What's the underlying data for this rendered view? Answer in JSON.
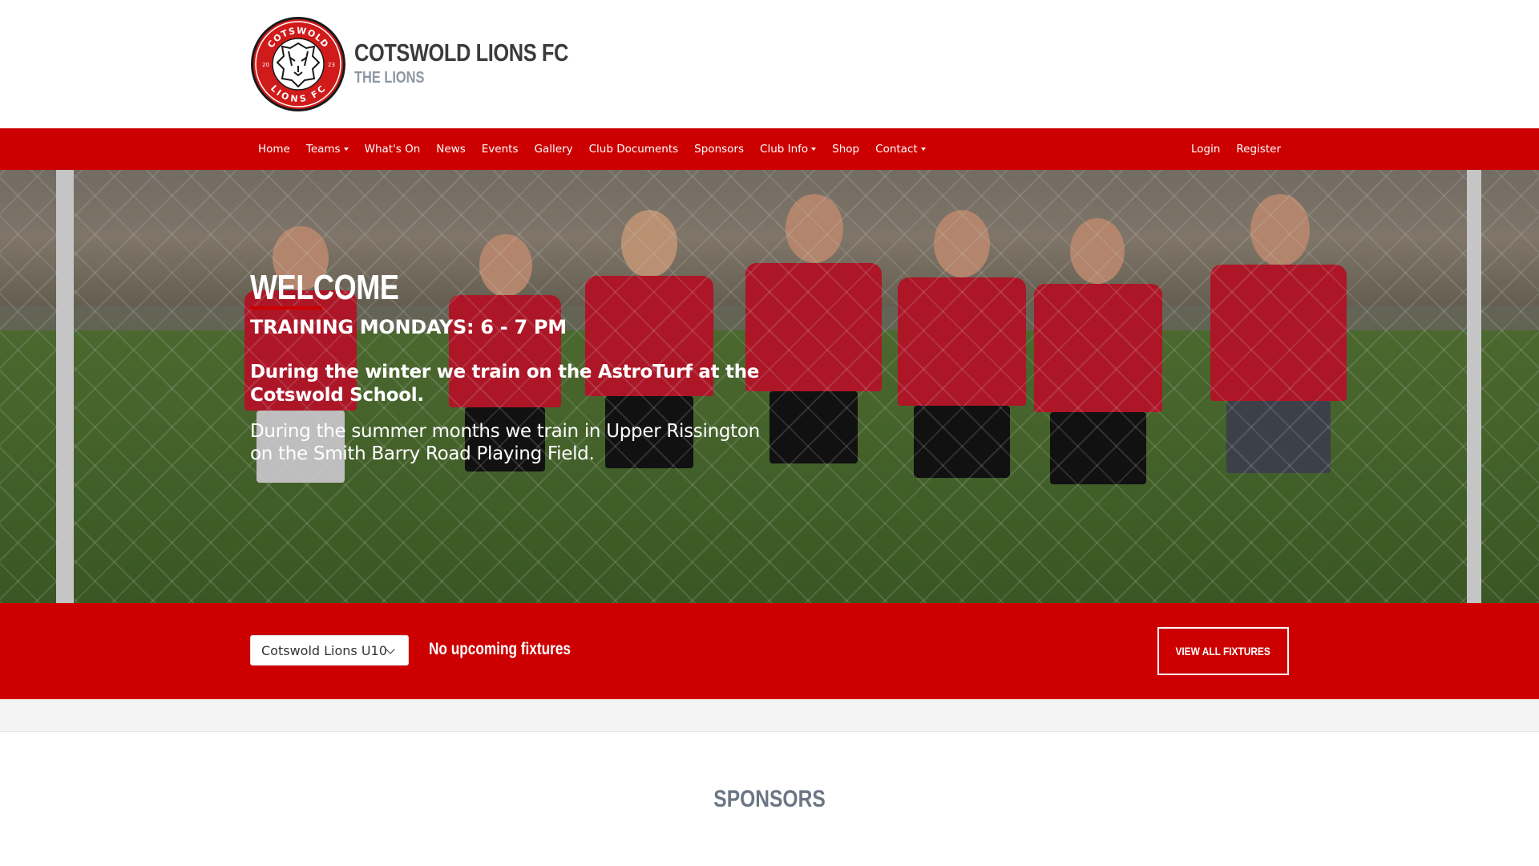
{
  "brand": {
    "title": "COTSWOLD LIONS FC",
    "subtitle": "THE LIONS",
    "crest_text_top": "COTSWOLD",
    "crest_text_bottom": "LIONS FC",
    "crest_year_left": "20",
    "crest_year_right": "23"
  },
  "nav": {
    "left": [
      {
        "label": "Home",
        "dropdown": false
      },
      {
        "label": "Teams",
        "dropdown": true
      },
      {
        "label": "What's On",
        "dropdown": false
      },
      {
        "label": "News",
        "dropdown": false
      },
      {
        "label": "Events",
        "dropdown": false
      },
      {
        "label": "Gallery",
        "dropdown": false
      },
      {
        "label": "Club Documents",
        "dropdown": false
      },
      {
        "label": "Sponsors",
        "dropdown": false
      },
      {
        "label": "Club Info",
        "dropdown": true
      },
      {
        "label": "Shop",
        "dropdown": false
      },
      {
        "label": "Contact",
        "dropdown": true
      }
    ],
    "right": [
      {
        "label": "Login"
      },
      {
        "label": "Register"
      }
    ]
  },
  "hero": {
    "heading": "WELCOME",
    "training": "TRAINING MONDAYS: 6 - 7 PM",
    "winter": "During the winter we train on the AstroTurf at the Cotswold School.",
    "summer": "During the summer months we train in Upper Rissington on the Smith Barry Road Playing Field."
  },
  "fixtures": {
    "team_selected": "Cotswold Lions U10",
    "status": "No upcoming fixtures",
    "view_all_label": "VIEW ALL FIXTURES"
  },
  "sponsors": {
    "title": "SPONSORS"
  },
  "colors": {
    "brand_red": "#cc0000",
    "heading_grey": "#6b7685",
    "title_dark": "#3b3b3b"
  }
}
